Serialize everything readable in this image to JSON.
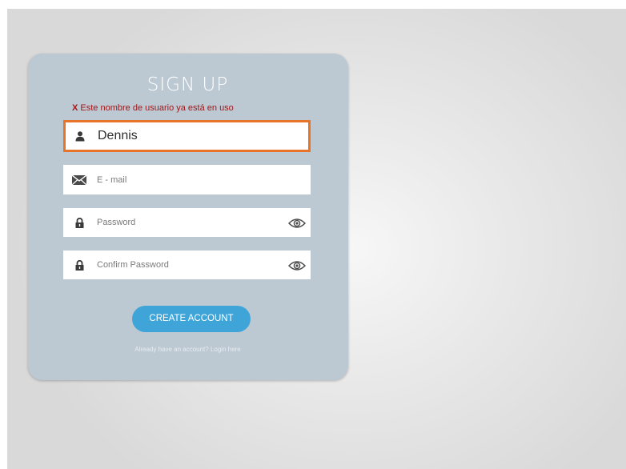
{
  "form": {
    "title": "SIGN UP",
    "error": {
      "mark": "X",
      "message": "Este nombre de usuario ya está en uso"
    },
    "fields": [
      {
        "icon": "user-icon",
        "value": "Dennis",
        "placeholder": ""
      },
      {
        "icon": "envelope-icon",
        "value": "",
        "placeholder": "E - mail"
      },
      {
        "icon": "lock-icon",
        "value": "",
        "placeholder": "Password",
        "trailing_icon": "eye-icon"
      },
      {
        "icon": "lock-icon",
        "value": "",
        "placeholder": "Confirm Password",
        "trailing_icon": "eye-icon"
      }
    ],
    "submit_label": "CREATE ACCOUNT",
    "login_link": "Already have an account? Login here"
  },
  "colors": {
    "card": "#bcc8d2",
    "focus_border": "#e8742a",
    "button": "#3fa4d8",
    "error": "#a0181a"
  }
}
